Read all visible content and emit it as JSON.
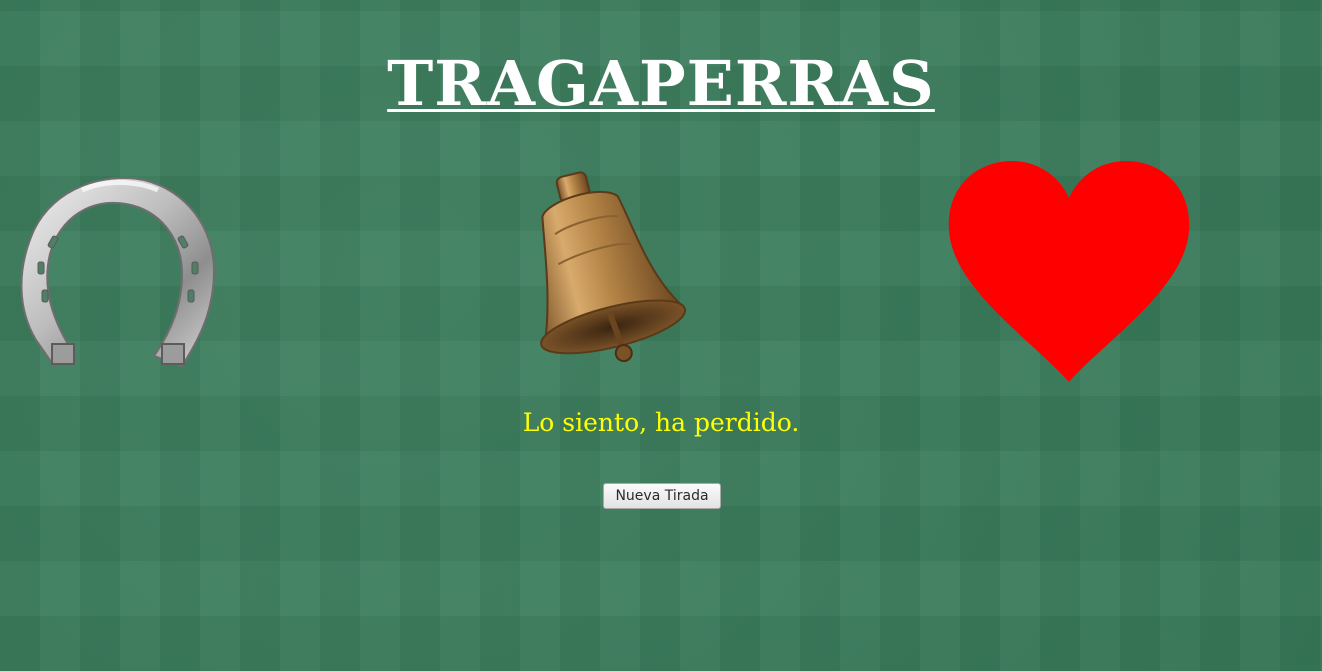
{
  "title": "TRAGAPERRAS",
  "reels": [
    {
      "symbol": "horseshoe",
      "icon": "horseshoe-icon"
    },
    {
      "symbol": "bell",
      "icon": "bell-icon"
    },
    {
      "symbol": "heart",
      "icon": "heart-icon"
    }
  ],
  "result_message": "Lo siento, ha perdido.",
  "spin_button_label": "Nueva Tirada",
  "colors": {
    "background": "#3a7d5c",
    "title": "#ffffff",
    "message": "#ffff00",
    "heart": "#ff0000"
  }
}
